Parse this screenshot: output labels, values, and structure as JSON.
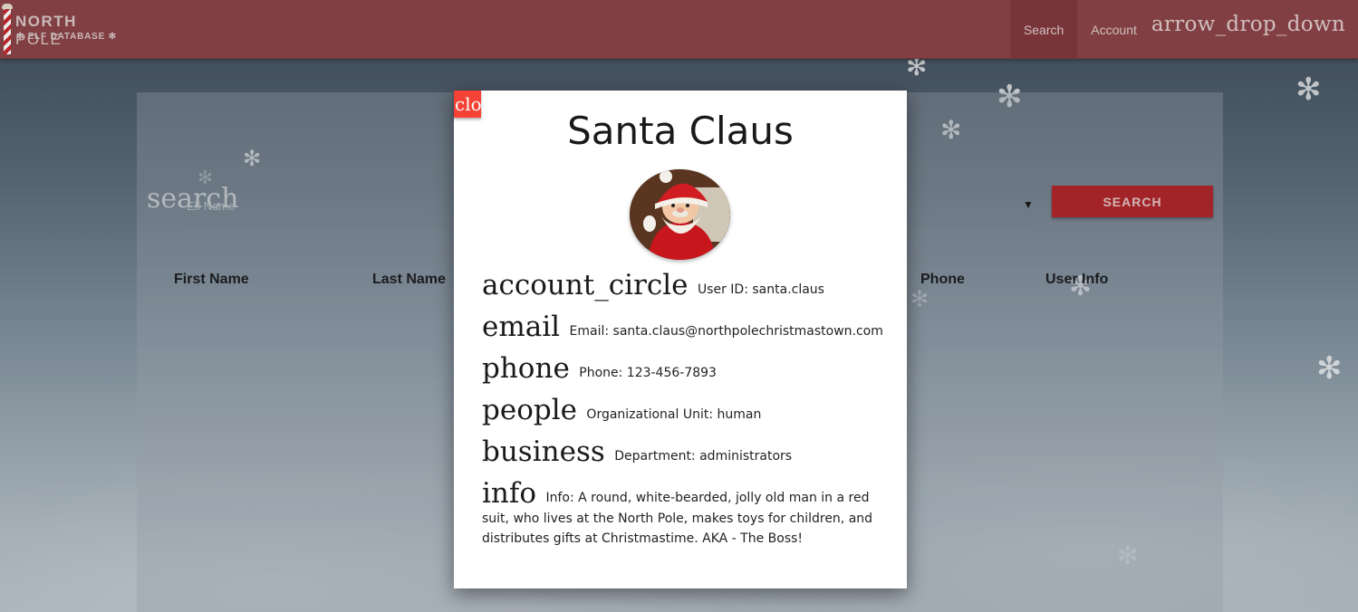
{
  "header": {
    "logo_title_bold": "NORTH",
    "logo_title_light": "POLE",
    "logo_subtitle": "ELF DATABASE",
    "nav": {
      "search_label": "Search",
      "account_label": "Account",
      "account_icon_text": "arrow_drop_down"
    }
  },
  "main": {
    "search_icon_text": "search",
    "search_placeholder": "Elf Name",
    "search_button_label": "SEARCH",
    "table_columns": [
      "First Name",
      "Last Name",
      "Phone",
      "User Info"
    ]
  },
  "modal": {
    "close_label": "close",
    "name": "Santa Claus",
    "details": [
      {
        "icon": "account_circle",
        "text": "User ID: santa.claus"
      },
      {
        "icon": "email",
        "text": "Email: santa.claus@northpolechristmastown.com"
      },
      {
        "icon": "phone",
        "text": "Phone: 123-456-7893"
      },
      {
        "icon": "people",
        "text": "Organizational Unit: human"
      },
      {
        "icon": "business",
        "text": "Department: administrators"
      },
      {
        "icon": "info",
        "text": "Info: A round, white-bearded, jolly old man in a red suit, who lives at the North Pole, makes toys for children, and distributes gifts at Christmastime. AKA - The Boss!"
      }
    ]
  },
  "colors": {
    "navbar": "#8e4549",
    "search_button": "#b0282c",
    "close_button": "#f44336"
  }
}
